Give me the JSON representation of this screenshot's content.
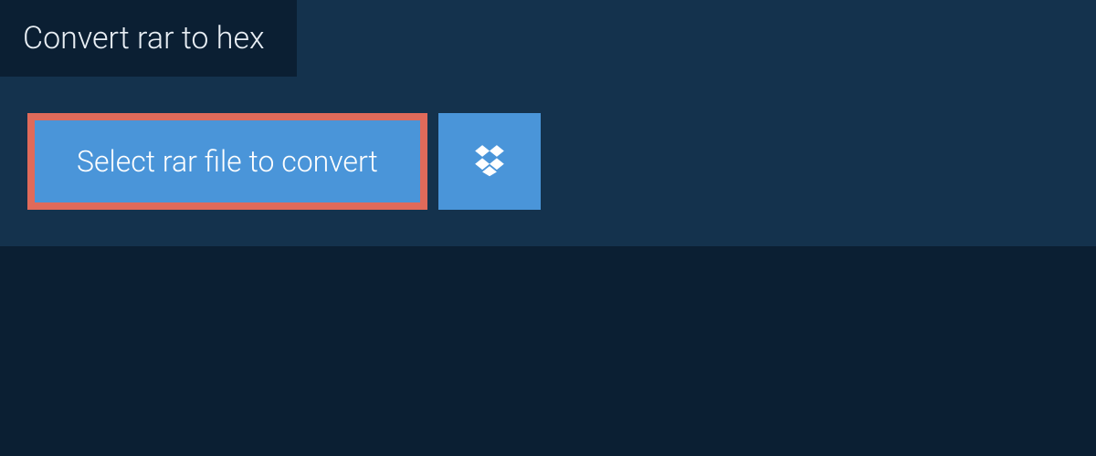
{
  "tab": {
    "title": "Convert rar to hex"
  },
  "actions": {
    "select_label": "Select rar file to convert"
  },
  "colors": {
    "page_bg": "#0b1f33",
    "panel_bg": "#14324d",
    "button_bg": "#4a95d9",
    "highlight_border": "#e06a5a",
    "text": "#ffffff"
  }
}
